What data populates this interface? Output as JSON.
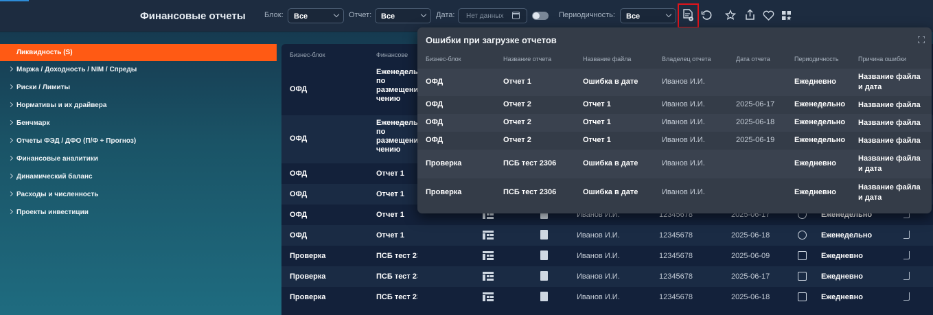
{
  "header": {
    "title": "Финансовые отчеты",
    "filters": {
      "block_label": "Блок:",
      "block_value": "Все",
      "report_label": "Отчет:",
      "report_value": "Все",
      "date_label": "Дата:",
      "date_placeholder": "Нет данных",
      "periodicity_label": "Периодичность:",
      "periodicity_value": "Все"
    },
    "icons": [
      "load-errors-icon",
      "refresh-icon",
      "star-icon",
      "share-icon",
      "heart-icon",
      "apps-icon"
    ]
  },
  "sidebar": {
    "items": [
      {
        "label": "Ликвидность (S)",
        "active": true
      },
      {
        "label": "Маржа / Доходность / NIM / Спреды"
      },
      {
        "label": "Риски / Лимиты"
      },
      {
        "label": "Нормативы и их драйвера"
      },
      {
        "label": "Бенчмарк"
      },
      {
        "label": "Отчеты ФЭД / ДФО (П/Ф + Прогноз)"
      },
      {
        "label": "Финансовые аналитики"
      },
      {
        "label": "Динамический баланс"
      },
      {
        "label": "Расходы и численность"
      },
      {
        "label": "Проекты инвестиции"
      }
    ]
  },
  "table": {
    "headers": [
      "Бизнес-блок",
      "Финансове"
    ],
    "rows": [
      {
        "block": "ОФД",
        "name": [
          "Еженедельн",
          "по",
          "размещени",
          "чению"
        ]
      },
      {
        "block": "ОФД",
        "name": [
          "Еженедельн",
          "по",
          "размещени",
          "чению"
        ]
      },
      {
        "block": "ОФД",
        "name": [
          "Отчет 1"
        ]
      },
      {
        "block": "ОФД",
        "name": [
          "Отчет 1"
        ]
      },
      {
        "block": "ОФД",
        "name": [
          "Отчет 1"
        ],
        "owner": "Иванов И.И.",
        "code": "12345678",
        "date": "2025-06-17",
        "period": "Еженедельно",
        "period_icon": "week-icon"
      },
      {
        "block": "ОФД",
        "name": [
          "Отчет 1"
        ],
        "owner": "Иванов И.И.",
        "code": "12345678",
        "date": "2025-06-18",
        "period": "Еженедельно",
        "period_icon": "week-icon"
      },
      {
        "block": "Проверка",
        "name": [
          "ПСБ тест 2306"
        ],
        "owner": "Иванов И.И.",
        "code": "12345678",
        "date": "2025-06-09",
        "period": "Ежедневно",
        "period_icon": "calendar-icon"
      },
      {
        "block": "Проверка",
        "name": [
          "ПСБ тест 2306"
        ],
        "owner": "Иванов И.И.",
        "code": "12345678",
        "date": "2025-06-17",
        "period": "Ежедневно",
        "period_icon": "calendar-icon"
      },
      {
        "block": "Проверка",
        "name": [
          "ПСБ тест 2306"
        ],
        "owner": "Иванов И.И.",
        "code": "12345678",
        "date": "2025-06-18",
        "period": "Ежедневно",
        "period_icon": "calendar-icon"
      }
    ]
  },
  "errors_popup": {
    "title": "Ошибки при загрузке отчетов",
    "headers": [
      "Бизнес-блок",
      "Название отчета",
      "Название файла",
      "Владелец отчета",
      "Дата отчета",
      "Периодичность",
      "Причина ошибки"
    ],
    "rows": [
      {
        "block": "ОФД",
        "report": "Отчет 1",
        "file": "Ошибка в дате",
        "owner": "Иванов И.И.",
        "date": "",
        "period": "Ежедневно",
        "reason": [
          "Название файла",
          "и дата"
        ]
      },
      {
        "block": "ОФД",
        "report": "Отчет 2",
        "file": "Отчет 1",
        "owner": "Иванов И.И.",
        "date": "2025-06-17",
        "period": "Еженедельно",
        "reason": [
          "Название файла"
        ]
      },
      {
        "block": "ОФД",
        "report": "Отчет 2",
        "file": "Отчет 1",
        "owner": "Иванов И.И.",
        "date": "2025-06-18",
        "period": "Еженедельно",
        "reason": [
          "Название файла"
        ]
      },
      {
        "block": "ОФД",
        "report": "Отчет 2",
        "file": "Отчет 1",
        "owner": "Иванов И.И.",
        "date": "2025-06-19",
        "period": "Еженедельно",
        "reason": [
          "Название файла"
        ]
      },
      {
        "block": "Проверка",
        "report": "ПСБ тест 2306",
        "file": "Ошибка в дате",
        "owner": "Иванов И.И.",
        "date": "",
        "period": "Ежедневно",
        "reason": [
          "Название файла",
          "и дата"
        ]
      },
      {
        "block": "Проверка",
        "report": "ПСБ тест 2306",
        "file": "Ошибка в дате",
        "owner": "Иванов И.И.",
        "date": "",
        "period": "Ежедневно",
        "reason": [
          "Название файла",
          "и дата"
        ]
      }
    ]
  },
  "colors": {
    "accent": "#ff5a14",
    "highlight": "#e0141b",
    "header_bg": "#1d2c40",
    "table_bg": "#13213a",
    "popup_bg": "#343c48"
  }
}
